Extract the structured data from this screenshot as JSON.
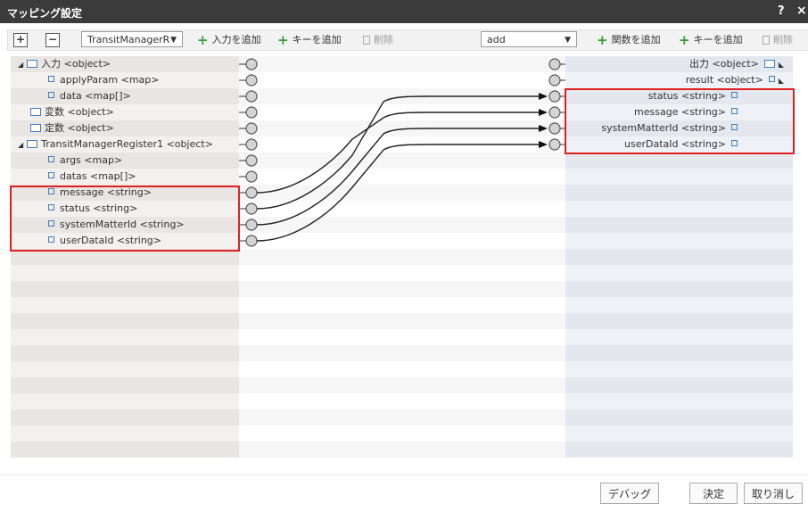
{
  "dialog": {
    "title": "マッピング設定",
    "help": "?",
    "close": "×"
  },
  "toolbar": {
    "expand_label": "+",
    "collapse_label": "−",
    "input_select_value": "TransitManagerR",
    "add_input_label": "入力を追加",
    "add_key_left_label": "キーを追加",
    "delete_left_label": "削除",
    "function_select_value": "add",
    "add_function_label": "関数を追加",
    "add_key_right_label": "キーを追加",
    "delete_right_label": "削除",
    "dropdown_arrow": "▼"
  },
  "input_tree": [
    {
      "label": "入力 <object>",
      "type": "folder",
      "indent": 0,
      "expanded": true
    },
    {
      "label": "applyParam <map>",
      "type": "leaf",
      "indent": 1
    },
    {
      "label": "data <map[]>",
      "type": "leaf",
      "indent": 1
    },
    {
      "label": "変数 <object>",
      "type": "folder",
      "indent": 0
    },
    {
      "label": "定数 <object>",
      "type": "folder",
      "indent": 0
    },
    {
      "label": "TransitManagerRegister1 <object>",
      "type": "folder",
      "indent": 0,
      "expanded": true
    },
    {
      "label": "args <map>",
      "type": "leaf",
      "indent": 1
    },
    {
      "label": "datas <map[]>",
      "type": "leaf",
      "indent": 1
    },
    {
      "label": "message <string>",
      "type": "leaf",
      "indent": 1
    },
    {
      "label": "status <string>",
      "type": "leaf",
      "indent": 1
    },
    {
      "label": "systemMatterId <string>",
      "type": "leaf",
      "indent": 1
    },
    {
      "label": "userDataId <string>",
      "type": "leaf",
      "indent": 1
    }
  ],
  "output_tree": [
    {
      "label": "出力 <object>",
      "type": "folder"
    },
    {
      "label": "result <object>",
      "type": "leaf",
      "marker": true
    },
    {
      "label": "status <string>",
      "type": "leaf"
    },
    {
      "label": "message <string>",
      "type": "leaf"
    },
    {
      "label": "systemMatterId <string>",
      "type": "leaf"
    },
    {
      "label": "userDataId <string>",
      "type": "leaf"
    }
  ],
  "expand_glyph": "◢",
  "collapse_glyph": "◣",
  "mappings": [
    {
      "from": "message <string>",
      "to": "message <string>"
    },
    {
      "from": "status <string>",
      "to": "status <string>"
    },
    {
      "from": "systemMatterId <string>",
      "to": "systemMatterId <string>"
    },
    {
      "from": "userDataId <string>",
      "to": "userDataId <string>"
    }
  ],
  "footer": {
    "debug_label": "デバッグ",
    "ok_label": "決定",
    "cancel_label": "取り消し"
  },
  "colors": {
    "titlebar": "#3b3b3b",
    "highlight": "#e02020",
    "add_icon": "#2fa12f",
    "tree_icon": "#3a7fc9"
  }
}
